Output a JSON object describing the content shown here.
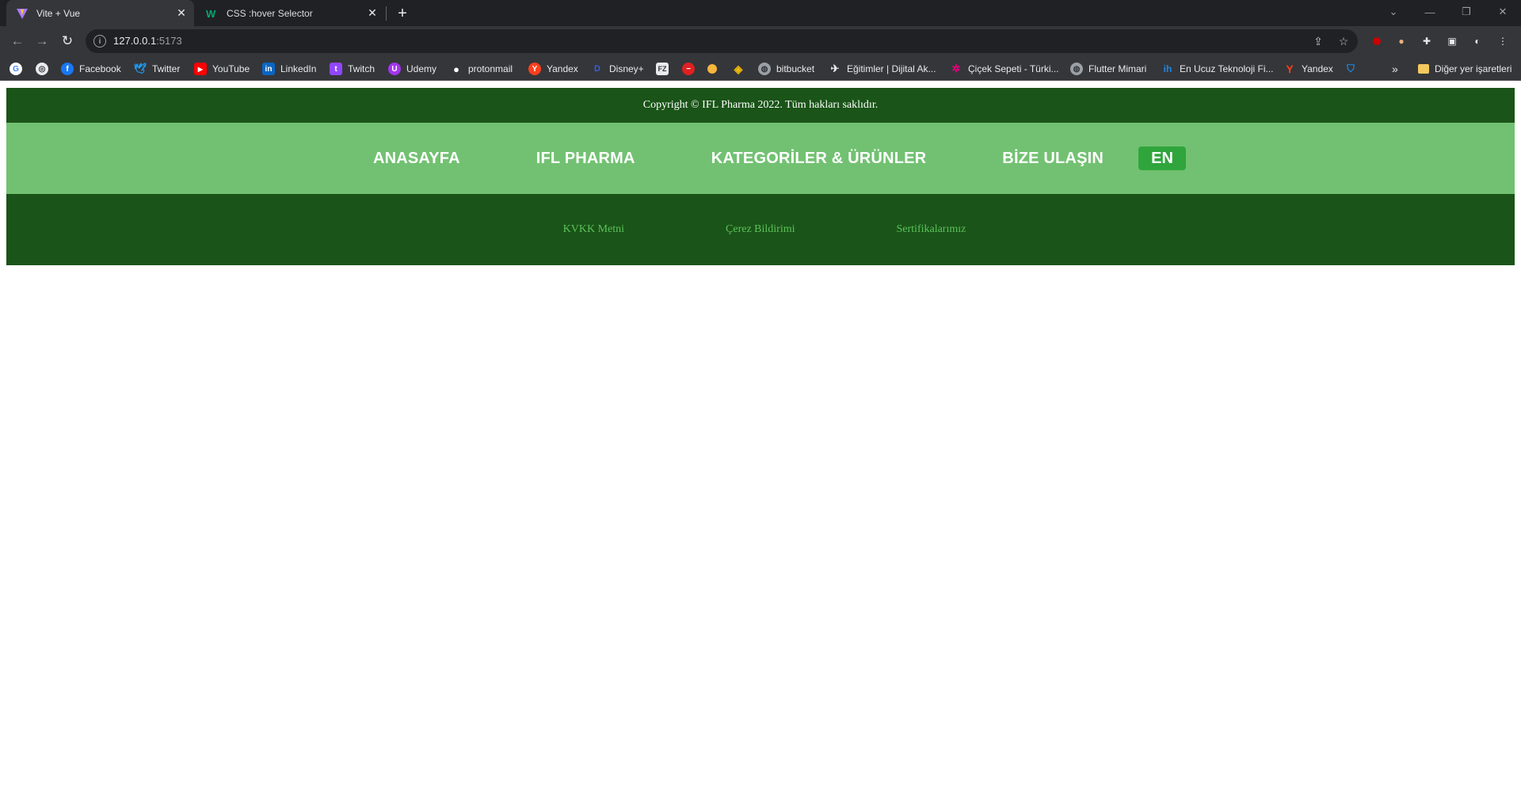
{
  "browser": {
    "tabs": [
      {
        "title": "Vite + Vue",
        "icon": "vite-icon",
        "active": true
      },
      {
        "title": "CSS :hover Selector",
        "icon": "w3schools-icon",
        "active": false
      }
    ],
    "url_host": "127.0.0.1",
    "url_port": ":5173",
    "bookmarks": [
      {
        "label": "",
        "icon": "google-icon",
        "color": "#ffffff"
      },
      {
        "label": "",
        "icon": "globe-bookmark-icon",
        "color": "#e8eaed"
      },
      {
        "label": "Facebook",
        "icon": "facebook-icon",
        "color": "#1877f2"
      },
      {
        "label": "Twitter",
        "icon": "twitter-icon",
        "color": "#1d9bf0"
      },
      {
        "label": "YouTube",
        "icon": "youtube-icon",
        "color": "#ff0000"
      },
      {
        "label": "LinkedIn",
        "icon": "linkedin-icon",
        "color": "#0a66c2"
      },
      {
        "label": "Twitch",
        "icon": "twitch-icon",
        "color": "#9146ff"
      },
      {
        "label": "Udemy",
        "icon": "udemy-icon",
        "color": "#a435f0"
      },
      {
        "label": "protonmail",
        "icon": "protonmail-icon",
        "color": "#ffffff"
      },
      {
        "label": "Yandex",
        "icon": "yandex-icon",
        "color": "#fc3f1d"
      },
      {
        "label": "Disney+",
        "icon": "disney-icon",
        "color": "#1a3a8a"
      },
      {
        "label": "",
        "icon": "fz-icon",
        "color": "#e8eaed"
      },
      {
        "label": "",
        "icon": "redbadge-icon",
        "color": "#e02020"
      },
      {
        "label": "",
        "icon": "dot-icon",
        "color": "#f5b63c"
      },
      {
        "label": "",
        "icon": "binance-icon",
        "color": "#f0b90b"
      },
      {
        "label": "bitbucket",
        "icon": "globe-icon",
        "color": "#9aa0a6"
      },
      {
        "label": "Eğitimler | Dijital Ak...",
        "icon": "plane-icon",
        "color": "#e8eaed"
      },
      {
        "label": "Çiçek Sepeti - Türki...",
        "icon": "flower-icon",
        "color": "#e6007e"
      },
      {
        "label": "Flutter Mimari",
        "icon": "globe-icon",
        "color": "#9aa0a6"
      },
      {
        "label": "En Ucuz Teknoloji Fi...",
        "icon": "ih-icon",
        "color": "#1e88e5"
      },
      {
        "label": "Yandex",
        "icon": "yandex-y-icon",
        "color": "#fc3f1d"
      },
      {
        "label": "",
        "icon": "shield-icon",
        "color": "#1e88e5"
      }
    ],
    "more_bookmarks": "»",
    "other_bookmarks": "Diğer yer işaretleri"
  },
  "footer": {
    "copyright": "Copyright © IFL Pharma 2022. Tüm hakları saklıdır.",
    "menu": [
      "ANASAYFA",
      "IFL PHARMA",
      "KATEGORİLER & ÜRÜNLER",
      "BİZE ULAŞIN"
    ],
    "language_button": "EN",
    "links": [
      "KVKK Metni",
      "Çerez Bildirimi",
      "Sertifikalarımız"
    ]
  },
  "colors": {
    "dark_green": "#1a5418",
    "light_green": "#72c172",
    "button_green": "#2fa53b",
    "link_green": "#5bc15b"
  }
}
